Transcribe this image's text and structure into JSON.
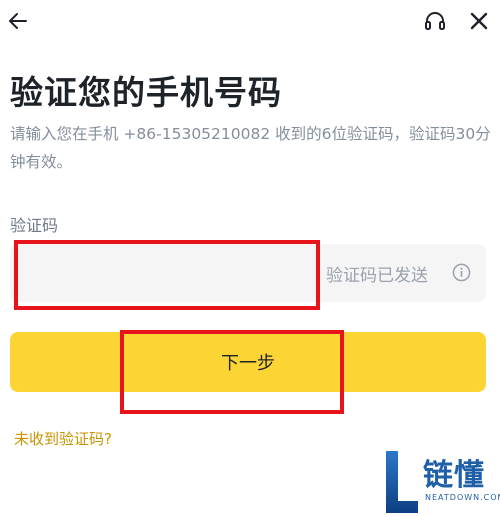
{
  "header": {
    "back_icon": "arrow-left-icon",
    "support_icon": "headset-icon",
    "close_icon": "close-icon"
  },
  "title": "验证您的手机号码",
  "description": "请输入您在手机 +86-15305210082 收到的6位验证码，验证码30分钟有效。",
  "code_field": {
    "label": "验证码",
    "value": "",
    "status_text": "验证码已发送",
    "info_icon": "info-icon"
  },
  "next_button": {
    "label": "下一步",
    "color": "#fcd535"
  },
  "resend_link": {
    "label": "未收到验证码?",
    "color": "#c99400"
  },
  "annotation_color": "#e8141c",
  "watermark": {
    "text": "链懂",
    "sub": "NEATDOWN.COM",
    "color": "#1f5fa8"
  }
}
